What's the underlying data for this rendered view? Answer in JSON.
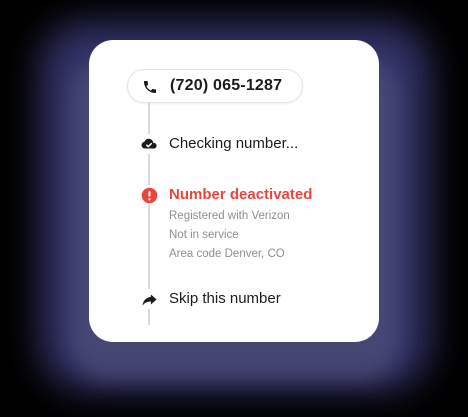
{
  "phone": {
    "number": "(720) 065-1287",
    "icon": "phone-icon"
  },
  "steps": [
    {
      "label": "Checking number...",
      "icon": "cloud-check-icon",
      "status": "in-progress"
    },
    {
      "label": "Number deactivated",
      "icon": "alert-circle-icon",
      "status": "error",
      "details": [
        "Registered with Verizon",
        "Not in service",
        "Area code Denver, CO"
      ]
    },
    {
      "label": "Skip this number",
      "icon": "forward-arrow-icon",
      "status": "action"
    }
  ],
  "colors": {
    "error": "#e8463f",
    "text": "#1c1c1c",
    "muted": "#8f8f8f",
    "line": "#d9d9d9",
    "card": "#ffffff"
  }
}
